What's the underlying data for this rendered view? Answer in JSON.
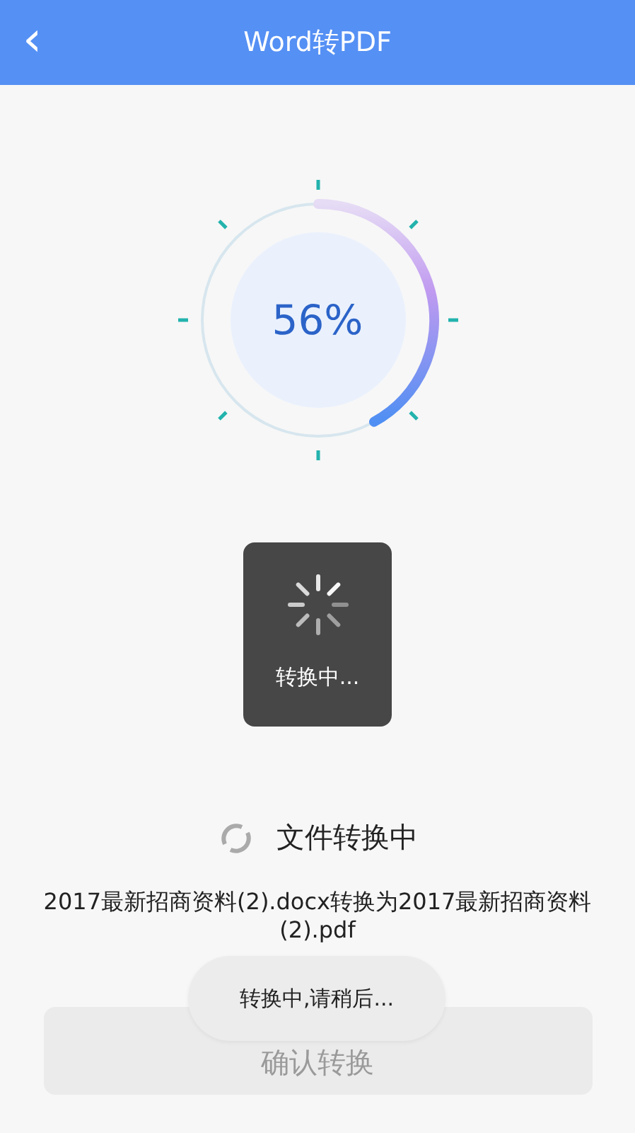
{
  "header": {
    "back_icon": "‹",
    "title": "Word转PDF"
  },
  "progress": {
    "reading": "56%"
  },
  "loading_dialog": {
    "label": "转换中..."
  },
  "status": {
    "text": "文件转换中"
  },
  "file_line": "2017最新招商资料(2).docx转换为2017最新招商资料(2).pdf",
  "toast": "转换中,请稍后...",
  "confirm_button": {
    "label": "确认转换",
    "disabled": true
  }
}
